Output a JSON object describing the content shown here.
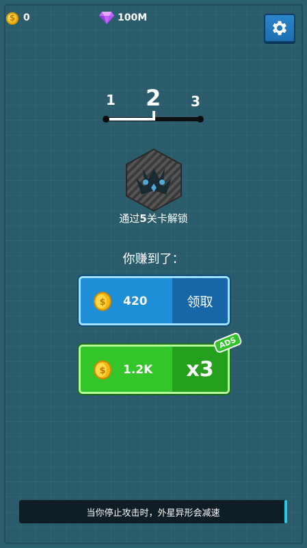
{
  "currency": {
    "coins": "0",
    "gems": "100M"
  },
  "settings": {
    "icon": "gear-icon"
  },
  "level_progress": {
    "prev": "1",
    "current": "2",
    "next": "3",
    "progress_fraction": 0.5
  },
  "unlock": {
    "icon": "locked-alien-ship-icon",
    "text_pre": "通过",
    "text_num": "5",
    "text_post": "关卡解锁"
  },
  "earned_label": "你赚到了：",
  "claim_button": {
    "amount": "420",
    "label": "领取",
    "icon": "coin-icon",
    "color": "#1e8fd6"
  },
  "ads_button": {
    "amount": "1.2K",
    "multiplier": "x3",
    "badge": "ADS",
    "icon": "coin-icon",
    "color": "#33c52a"
  },
  "tip": "当你停止攻击时，外星异形会减速"
}
